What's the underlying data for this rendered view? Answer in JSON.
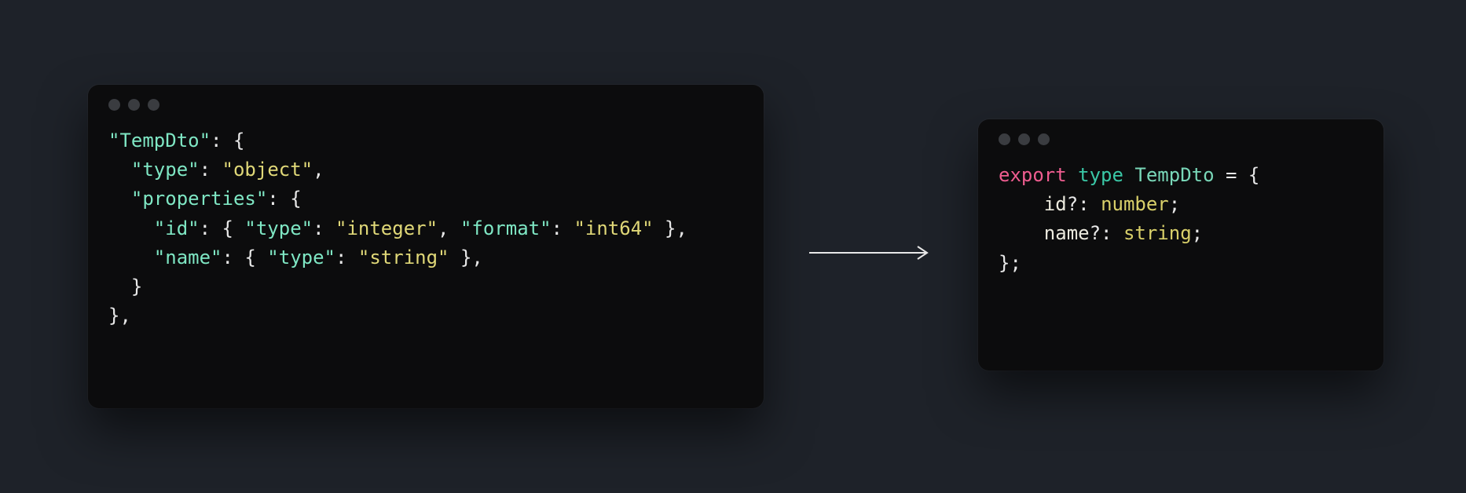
{
  "left": {
    "tokens": [
      [
        {
          "t": "\"TempDto\"",
          "c": "tok-key"
        },
        {
          "t": ": {",
          "c": "tok-punc"
        }
      ],
      [
        {
          "t": "  ",
          "c": "tok-punc"
        },
        {
          "t": "\"type\"",
          "c": "tok-key"
        },
        {
          "t": ": ",
          "c": "tok-punc"
        },
        {
          "t": "\"object\"",
          "c": "tok-str"
        },
        {
          "t": ",",
          "c": "tok-punc"
        }
      ],
      [
        {
          "t": "  ",
          "c": "tok-punc"
        },
        {
          "t": "\"properties\"",
          "c": "tok-key"
        },
        {
          "t": ": {",
          "c": "tok-punc"
        }
      ],
      [
        {
          "t": "    ",
          "c": "tok-punc"
        },
        {
          "t": "\"id\"",
          "c": "tok-key"
        },
        {
          "t": ": { ",
          "c": "tok-punc"
        },
        {
          "t": "\"type\"",
          "c": "tok-key"
        },
        {
          "t": ": ",
          "c": "tok-punc"
        },
        {
          "t": "\"integer\"",
          "c": "tok-str"
        },
        {
          "t": ", ",
          "c": "tok-punc"
        },
        {
          "t": "\"format\"",
          "c": "tok-key"
        },
        {
          "t": ": ",
          "c": "tok-punc"
        },
        {
          "t": "\"int64\"",
          "c": "tok-str"
        },
        {
          "t": " },",
          "c": "tok-punc"
        }
      ],
      [
        {
          "t": "    ",
          "c": "tok-punc"
        },
        {
          "t": "\"name\"",
          "c": "tok-key"
        },
        {
          "t": ": { ",
          "c": "tok-punc"
        },
        {
          "t": "\"type\"",
          "c": "tok-key"
        },
        {
          "t": ": ",
          "c": "tok-punc"
        },
        {
          "t": "\"string\"",
          "c": "tok-str"
        },
        {
          "t": " },",
          "c": "tok-punc"
        }
      ],
      [
        {
          "t": "  }",
          "c": "tok-punc"
        }
      ],
      [
        {
          "t": "},",
          "c": "tok-punc"
        }
      ]
    ],
    "plain": "\"TempDto\": {\n  \"type\": \"object\",\n  \"properties\": {\n    \"id\": { \"type\": \"integer\", \"format\": \"int64\" },\n    \"name\": { \"type\": \"string\" },\n  }\n},"
  },
  "right": {
    "tokens": [
      [
        {
          "t": "export",
          "c": "tok-kw1"
        },
        {
          "t": " ",
          "c": "tok-punc"
        },
        {
          "t": "type",
          "c": "tok-kw2"
        },
        {
          "t": " ",
          "c": "tok-punc"
        },
        {
          "t": "TempDto",
          "c": "tok-type"
        },
        {
          "t": " = {",
          "c": "tok-punc"
        }
      ],
      [
        {
          "t": "    ",
          "c": "tok-punc"
        },
        {
          "t": "id",
          "c": "tok-ident"
        },
        {
          "t": "?: ",
          "c": "tok-punc"
        },
        {
          "t": "number",
          "c": "tok-prim"
        },
        {
          "t": ";",
          "c": "tok-punc"
        }
      ],
      [
        {
          "t": "    ",
          "c": "tok-punc"
        },
        {
          "t": "name",
          "c": "tok-ident"
        },
        {
          "t": "?: ",
          "c": "tok-punc"
        },
        {
          "t": "string",
          "c": "tok-prim"
        },
        {
          "t": ";",
          "c": "tok-punc"
        }
      ],
      [
        {
          "t": "};",
          "c": "tok-punc"
        }
      ]
    ],
    "plain": "export type TempDto = {\n    id?: number;\n    name?: string;\n};"
  }
}
